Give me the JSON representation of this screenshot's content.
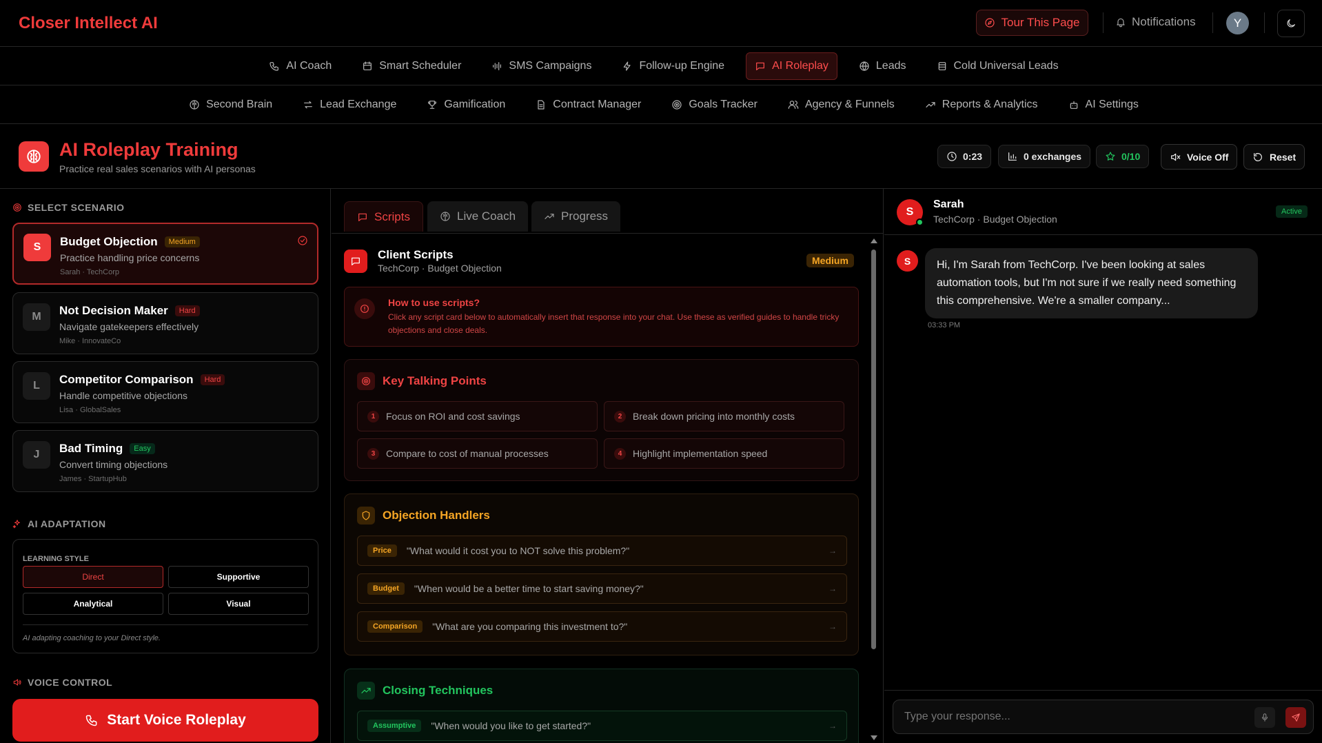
{
  "app": {
    "brand": "Closer Intellect AI",
    "tour_label": "Tour This Page",
    "notifications_label": "Notifications",
    "avatar_initial": "Y"
  },
  "nav_primary": [
    {
      "label": "AI Coach",
      "icon": "phone-icon"
    },
    {
      "label": "Smart Scheduler",
      "icon": "calendar-icon"
    },
    {
      "label": "SMS Campaigns",
      "icon": "waveform-icon"
    },
    {
      "label": "Follow-up Engine",
      "icon": "lightning-icon"
    },
    {
      "label": "AI Roleplay",
      "icon": "message-icon",
      "active": true
    },
    {
      "label": "Leads",
      "icon": "globe-icon"
    },
    {
      "label": "Cold Universal Leads",
      "icon": "database-icon"
    }
  ],
  "nav_secondary": [
    {
      "label": "Second Brain",
      "icon": "brain-icon"
    },
    {
      "label": "Lead Exchange",
      "icon": "exchange-icon"
    },
    {
      "label": "Gamification",
      "icon": "trophy-icon"
    },
    {
      "label": "Contract Manager",
      "icon": "document-icon"
    },
    {
      "label": "Goals Tracker",
      "icon": "target-icon"
    },
    {
      "label": "Agency & Funnels",
      "icon": "users-icon"
    },
    {
      "label": "Reports & Analytics",
      "icon": "trend-icon"
    },
    {
      "label": "AI Settings",
      "icon": "bot-icon"
    }
  ],
  "header": {
    "title": "AI Roleplay Training",
    "subtitle": "Practice real sales scenarios with AI personas",
    "timer": "0:23",
    "exchanges": "0 exchanges",
    "score": "0/10",
    "voice_label": "Voice Off",
    "reset_label": "Reset"
  },
  "left": {
    "select_label": "SELECT SCENARIO",
    "scenarios": [
      {
        "initial": "S",
        "title": "Budget Objection",
        "difficulty": "Medium",
        "desc": "Practice handling price concerns",
        "meta": "Sarah · TechCorp",
        "selected": true
      },
      {
        "initial": "M",
        "title": "Not Decision Maker",
        "difficulty": "Hard",
        "desc": "Navigate gatekeepers effectively",
        "meta": "Mike · InnovateCo"
      },
      {
        "initial": "L",
        "title": "Competitor Comparison",
        "difficulty": "Hard",
        "desc": "Handle competitive objections",
        "meta": "Lisa · GlobalSales"
      },
      {
        "initial": "J",
        "title": "Bad Timing",
        "difficulty": "Easy",
        "desc": "Convert timing objections",
        "meta": "James · StartupHub"
      }
    ],
    "adaptation_label": "AI ADAPTATION",
    "learning_style_label": "LEARNING STYLE",
    "styles": [
      "Direct",
      "Supportive",
      "Analytical",
      "Visual"
    ],
    "selected_style": "Direct",
    "adapt_note": "AI adapting coaching to your Direct style.",
    "voice_control_label": "VOICE CONTROL",
    "start_voice_label": "Start Voice Roleplay"
  },
  "middle": {
    "tabs": [
      "Scripts",
      "Live Coach",
      "Progress"
    ],
    "active_tab": "Scripts",
    "client_scripts_title": "Client Scripts",
    "client_scripts_sub": "TechCorp · Budget Objection",
    "difficulty": "Medium",
    "howto_title": "How to use scripts?",
    "howto_text": "Click any script card below to automatically insert that response into your chat. Use these as verified guides to handle tricky objections and close deals.",
    "talking_points_title": "Key Talking Points",
    "talking_points": [
      {
        "num": "1",
        "text": "Focus on ROI and cost savings"
      },
      {
        "num": "2",
        "text": "Break down pricing into monthly costs"
      },
      {
        "num": "3",
        "text": "Compare to cost of manual processes"
      },
      {
        "num": "4",
        "text": "Highlight implementation speed"
      }
    ],
    "objections_title": "Objection Handlers",
    "objections": [
      {
        "tag": "Price",
        "text": "\"What would it cost you to NOT solve this problem?\""
      },
      {
        "tag": "Budget",
        "text": "\"When would be a better time to start saving money?\""
      },
      {
        "tag": "Comparison",
        "text": "\"What are you comparing this investment to?\""
      }
    ],
    "closing_title": "Closing Techniques",
    "closing": [
      {
        "tag": "Assumptive",
        "text": "\"When would you like to get started?\""
      }
    ]
  },
  "chat": {
    "persona_initial": "S",
    "persona_name": "Sarah",
    "persona_sub": "TechCorp · Budget Objection",
    "status": "Active",
    "messages": [
      {
        "text": "Hi, I'm Sarah from TechCorp. I've been looking at sales automation tools, but I'm not sure if we really need something this comprehensive. We're a smaller company...",
        "time": "03:33 PM"
      }
    ],
    "input_placeholder": "Type your response..."
  },
  "colors": {
    "accent": "#ef3b3b",
    "medium": "#f5a524",
    "easy": "#22c55e",
    "background": "#000000"
  }
}
